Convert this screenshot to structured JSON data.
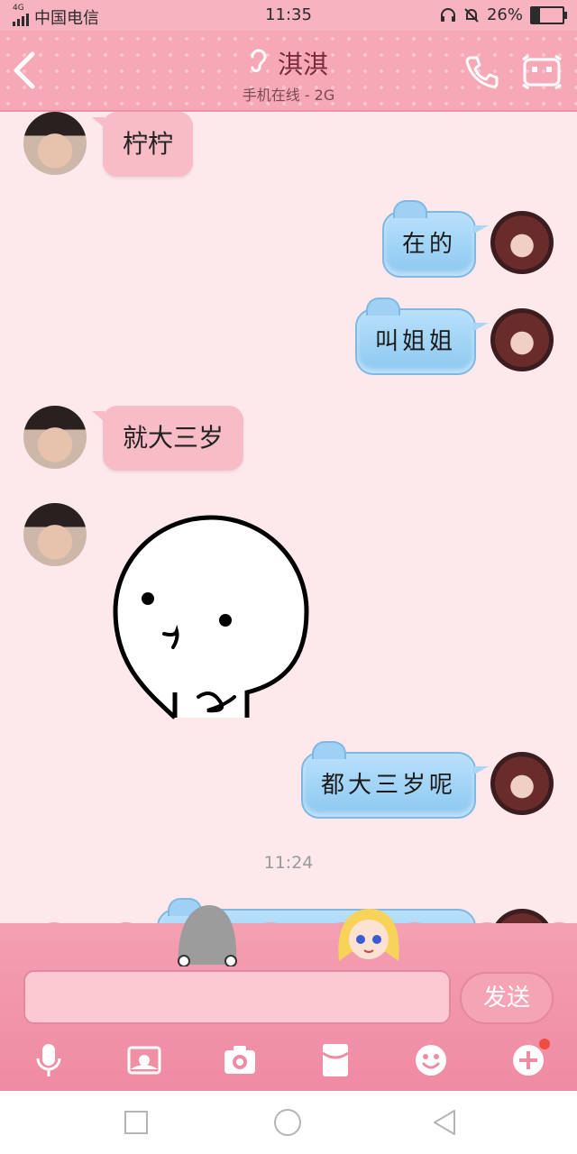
{
  "status_bar": {
    "network_label": "4G",
    "carrier": "中国电信",
    "time": "11:35",
    "battery_percent": "26%",
    "battery_level": 0.26
  },
  "header": {
    "contact_name": "淇淇",
    "status": "手机在线 - 2G"
  },
  "messages": [
    {
      "side": "in",
      "text": "柠柠"
    },
    {
      "side": "out",
      "text": "在的"
    },
    {
      "side": "out",
      "text": "叫姐姐"
    },
    {
      "side": "in",
      "text": "就大三岁"
    },
    {
      "side": "in",
      "type": "sticker",
      "sticker_icon": "round-face-sticker-icon"
    },
    {
      "side": "out",
      "text": "都大三岁呢"
    }
  ],
  "timestamp": "11:24",
  "input": {
    "value": "",
    "send_label": "发送"
  },
  "toolbar": {
    "items": [
      "microphone-icon",
      "image-icon",
      "camera-icon",
      "red-packet-icon",
      "emoji-icon",
      "plus-icon"
    ]
  },
  "colors": {
    "header_bg": "#f6a8b6",
    "incoming_bubble": "#f7bcc6",
    "outgoing_bubble": "#9fd1f4",
    "chat_bg": "#fde9ec",
    "badge": "#f24b3f"
  }
}
